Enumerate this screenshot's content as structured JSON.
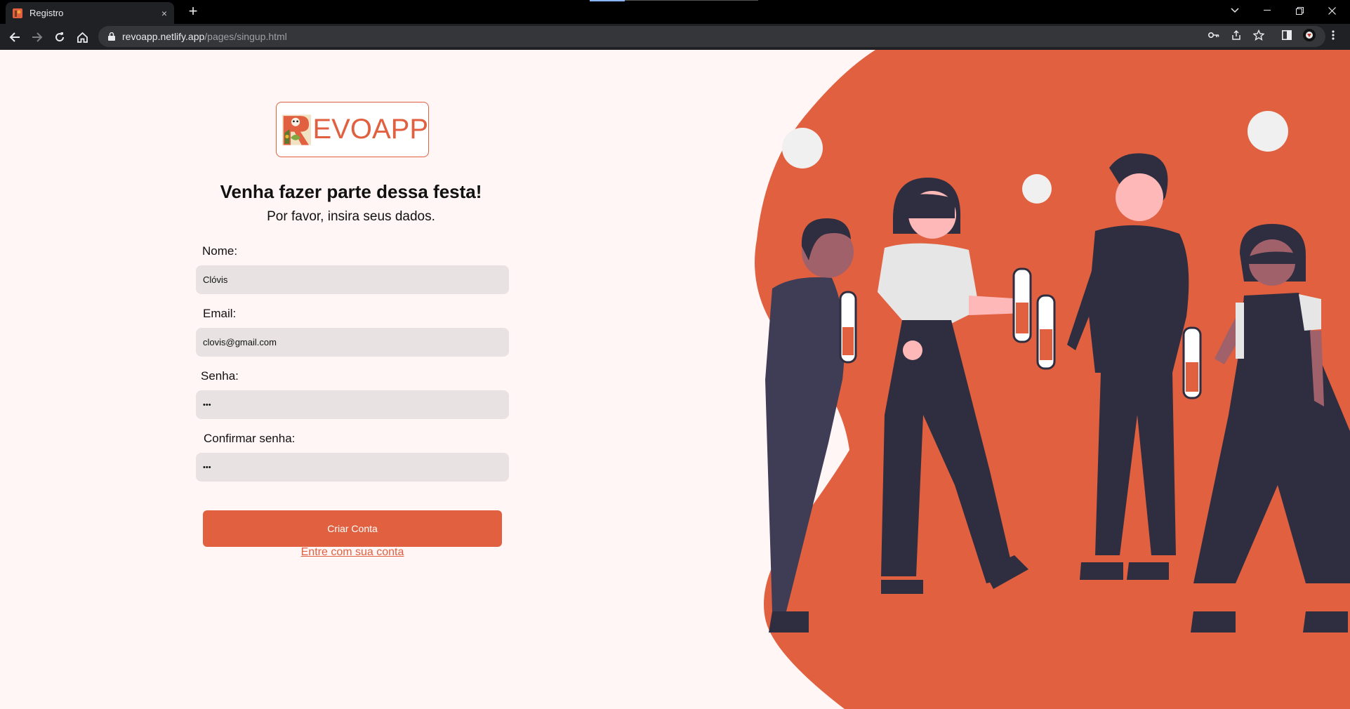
{
  "browser": {
    "tab_title": "Registro",
    "tab_close": "×",
    "new_tab": "+",
    "url_host": "revoapp.netlify.app",
    "url_path": "/pages/singup.html"
  },
  "page": {
    "logo_text": "EVOAPP",
    "logo_initial": "R",
    "heading": "Venha fazer parte dessa festa!",
    "subheading": "Por favor, insira seus dados.",
    "form": {
      "name_label": "Nome:",
      "name_value": "Clóvis",
      "email_label": "Email:",
      "email_value": "clovis@gmail.com",
      "password_label": "Senha:",
      "password_value": "•••",
      "confirm_label": "Confirmar senha:",
      "confirm_value": "•••",
      "submit_label": "Criar Conta",
      "login_link": "Entre com sua conta"
    }
  },
  "colors": {
    "accent": "#e0603f",
    "page_bg": "#fff6f5",
    "input_bg": "#e8e2e2",
    "figure_dark": "#2f2e41"
  }
}
